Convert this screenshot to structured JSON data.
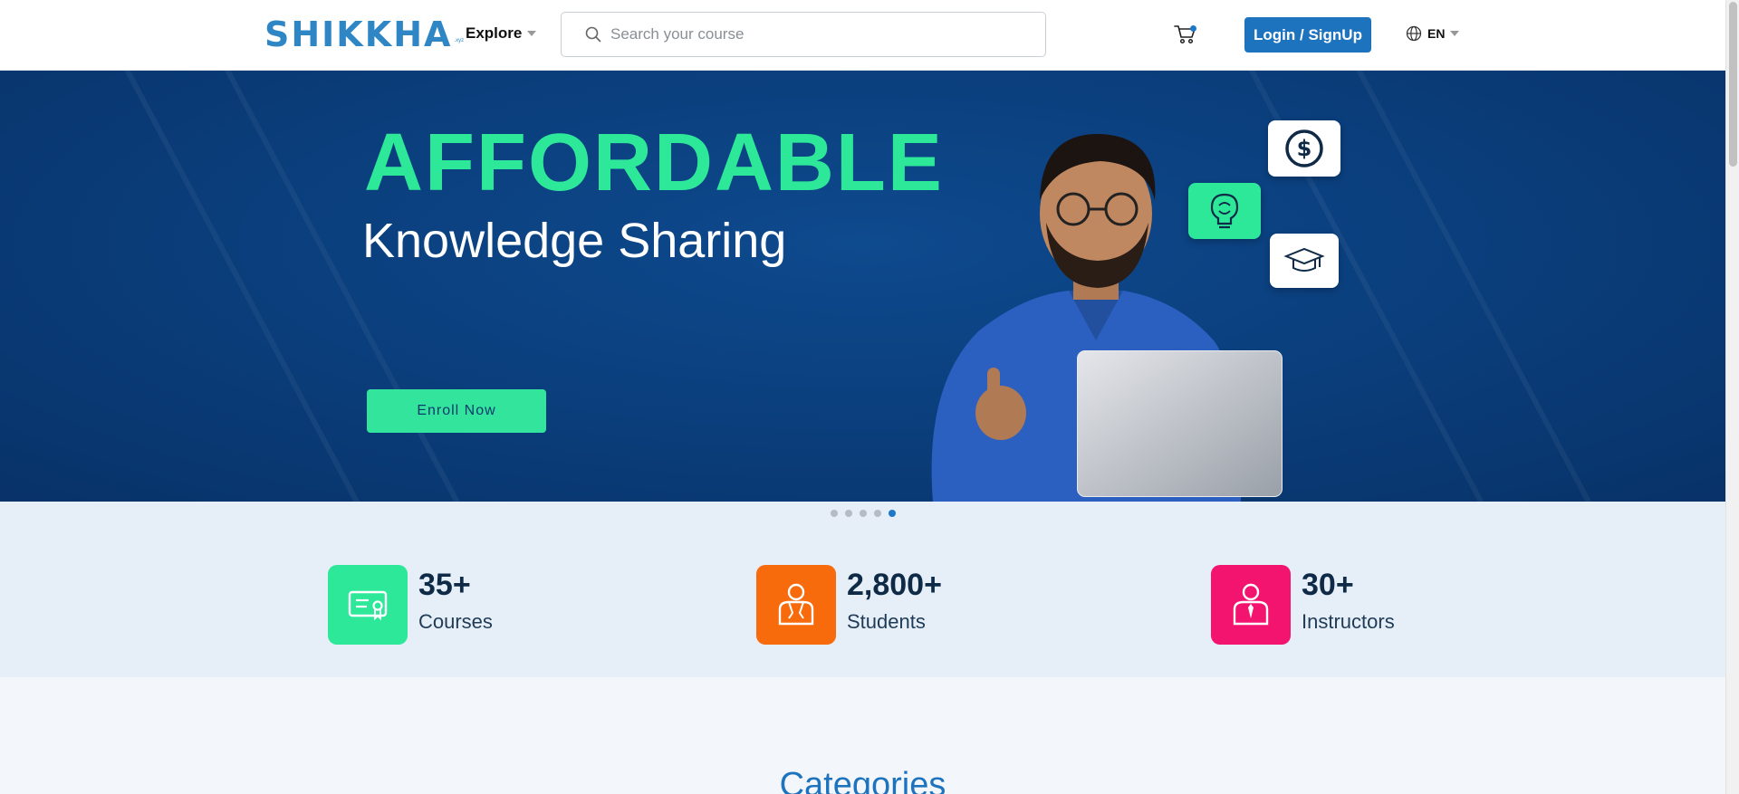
{
  "header": {
    "logo_text": "SHIKKHA",
    "logo_sub": ".xyz",
    "explore_label": "Explore",
    "search_placeholder": "Search your course",
    "login_label": "Login / SignUp",
    "language": "EN"
  },
  "hero": {
    "title": "AFFORDABLE",
    "subtitle": "Knowledge Sharing",
    "cta_label": "Enroll Now",
    "slides": 5,
    "active_slide": 5
  },
  "stats": [
    {
      "value": "35+",
      "label": "Courses",
      "icon": "certificate-icon",
      "color": "#2ee89a"
    },
    {
      "value": "2,800+",
      "label": "Students",
      "icon": "student-icon",
      "color": "#f76b0c"
    },
    {
      "value": "30+",
      "label": "Instructors",
      "icon": "instructor-icon",
      "color": "#f2146f"
    }
  ],
  "sections": {
    "categories_title": "Categories"
  },
  "colors": {
    "brand": "#1e73be",
    "accent": "#2ee89a",
    "hero_bg": "#0a3d7a"
  }
}
